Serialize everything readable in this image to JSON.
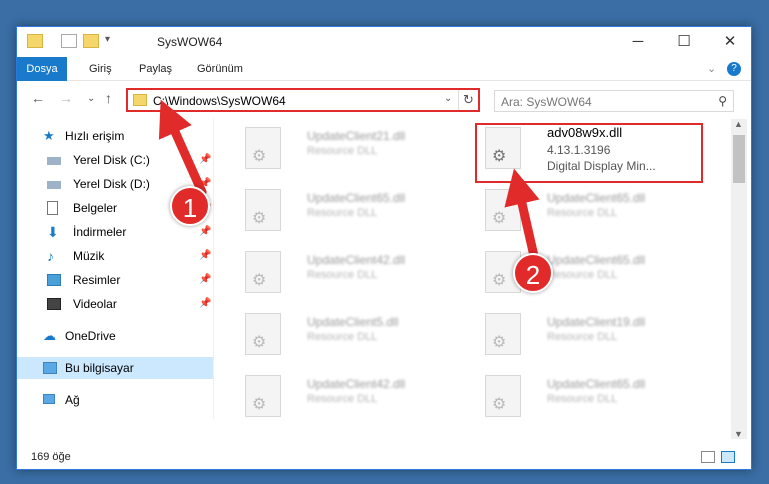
{
  "window": {
    "title": "SysWOW64"
  },
  "ribbon": {
    "tabs": [
      "Dosya",
      "Giriş",
      "Paylaş",
      "Görünüm"
    ]
  },
  "address": {
    "path": "C:\\Windows\\SysWOW64"
  },
  "search": {
    "placeholder": "Ara: SysWOW64"
  },
  "sidebar": {
    "items": [
      {
        "label": "Hızlı erişim",
        "icon": "star-icon"
      },
      {
        "label": "Yerel Disk (C:)",
        "icon": "drive-icon"
      },
      {
        "label": "Yerel Disk (D:)",
        "icon": "drive-icon"
      },
      {
        "label": "Belgeler",
        "icon": "document-icon"
      },
      {
        "label": "İndirmeler",
        "icon": "download-icon"
      },
      {
        "label": "Müzik",
        "icon": "music-icon"
      },
      {
        "label": "Resimler",
        "icon": "pictures-icon"
      },
      {
        "label": "Videolar",
        "icon": "video-icon"
      },
      {
        "label": "OneDrive",
        "icon": "cloud-icon"
      },
      {
        "label": "Bu bilgisayar",
        "icon": "computer-icon"
      },
      {
        "label": "Ağ",
        "icon": "network-icon"
      }
    ]
  },
  "files": [
    {
      "name": "UpdateClient21.dll",
      "desc": "Resource DLL"
    },
    {
      "name": "adv08w9x.dll",
      "version": "4.13.1.3196",
      "desc": "Digital Display Min..."
    },
    {
      "name": "UpdateClient65.dll",
      "desc": "Resource DLL"
    },
    {
      "name": "UpdateClient65.dll",
      "desc": "Resource DLL"
    },
    {
      "name": "UpdateClient42.dll",
      "desc": "Resource DLL"
    },
    {
      "name": "UpdateClient65.dll",
      "desc": "Resource DLL"
    },
    {
      "name": "UpdateClient5.dll",
      "desc": "Resource DLL"
    },
    {
      "name": "UpdateClient19.dll",
      "desc": "Resource DLL"
    },
    {
      "name": "UpdateClient42.dll",
      "desc": "Resource DLL"
    },
    {
      "name": "UpdateClient65.dll",
      "desc": "Resource DLL"
    }
  ],
  "status": {
    "count": "169 öğe"
  },
  "annotations": {
    "step1": "1",
    "step2": "2"
  },
  "colors": {
    "accent": "#1979ca",
    "highlight": "#e12b2b"
  }
}
